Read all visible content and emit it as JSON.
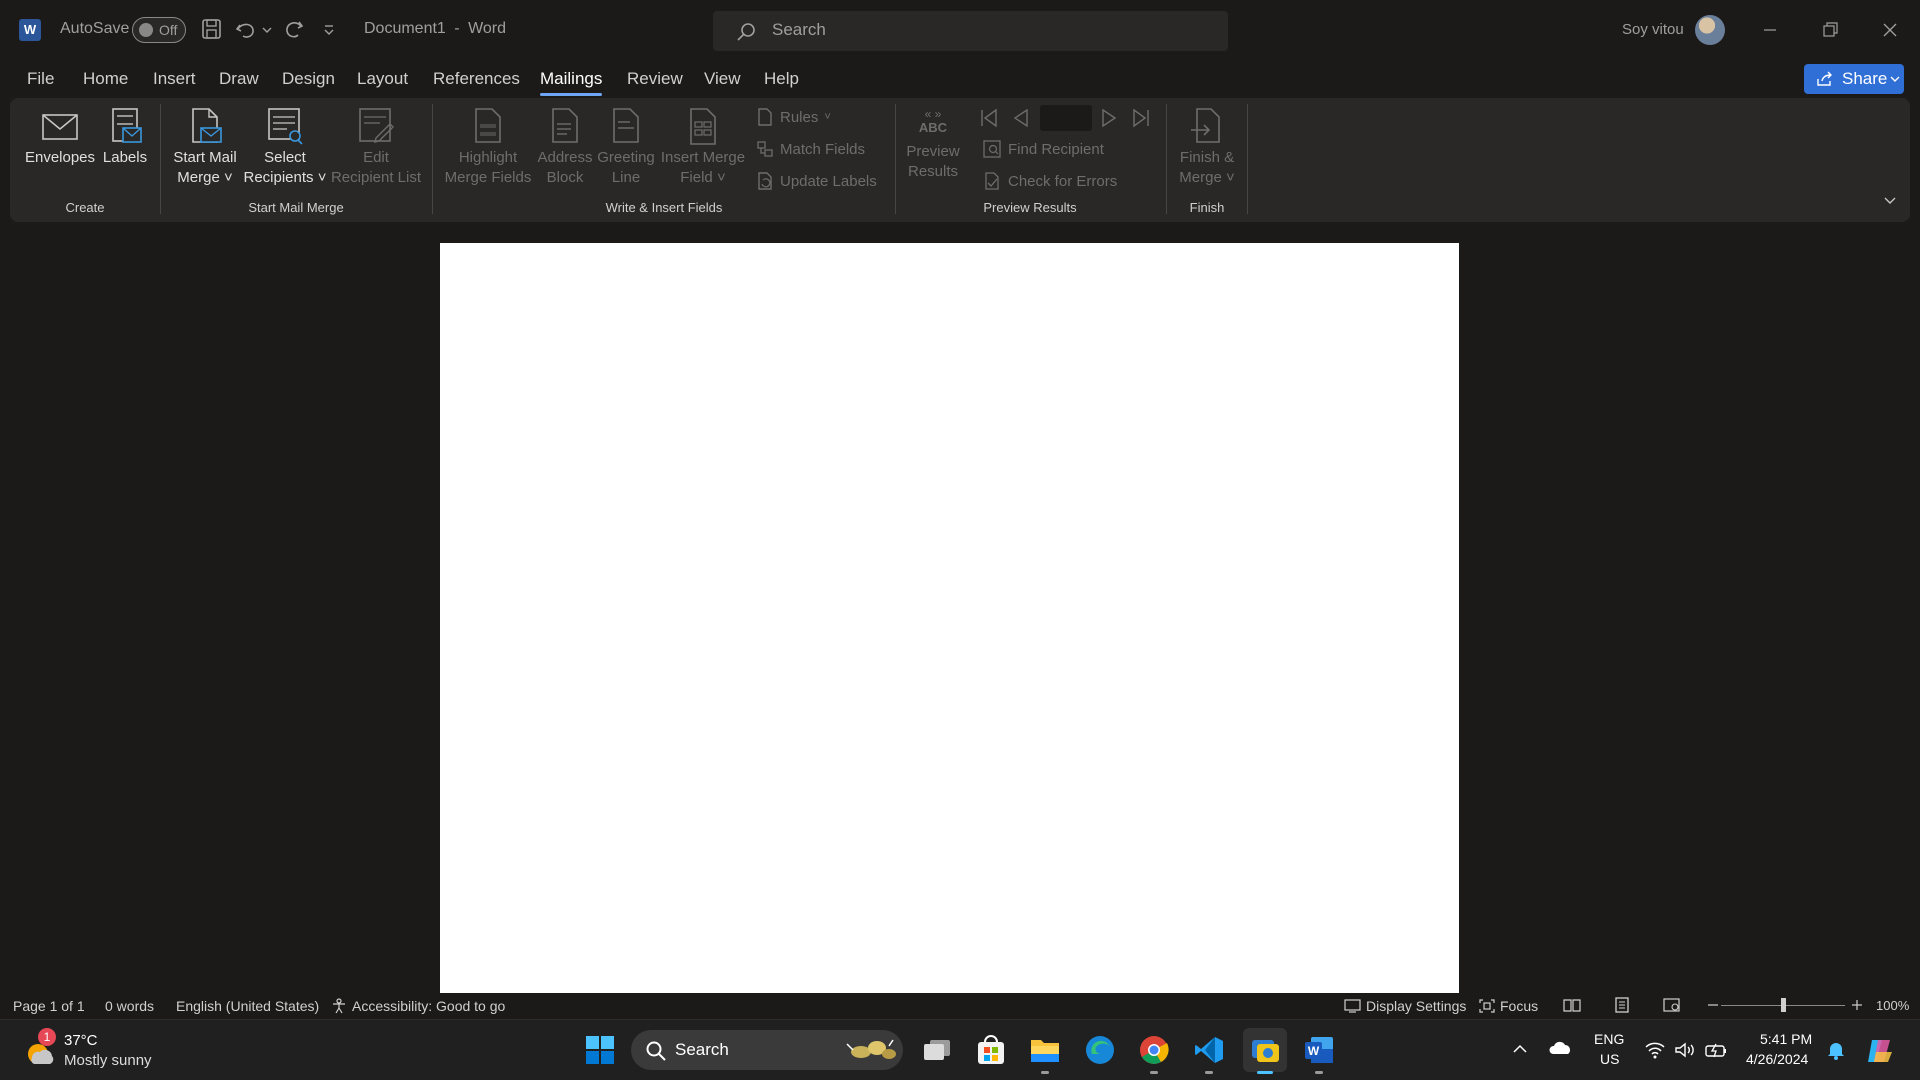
{
  "titlebar": {
    "autosave_label": "AutoSave",
    "autosave_state": "Off",
    "document_title": "Document1",
    "separator": "-",
    "app_name": "Word",
    "search_placeholder": "Search",
    "user_name": "Soy vitou"
  },
  "tabs": [
    "File",
    "Home",
    "Insert",
    "Draw",
    "Design",
    "Layout",
    "References",
    "Mailings",
    "Review",
    "View",
    "Help"
  ],
  "active_tab": "Mailings",
  "share_label": "Share",
  "ribbon": {
    "create": {
      "group": "Create",
      "envelopes": "Envelopes",
      "labels": "Labels"
    },
    "start_mail_merge": {
      "group": "Start Mail Merge",
      "start_l1": "Start Mail",
      "start_l2": "Merge",
      "select_l1": "Select",
      "select_l2": "Recipients",
      "edit_l1": "Edit",
      "edit_l2": "Recipient List"
    },
    "write_insert": {
      "group": "Write & Insert Fields",
      "highlight_l1": "Highlight",
      "highlight_l2": "Merge Fields",
      "address_l1": "Address",
      "address_l2": "Block",
      "greeting_l1": "Greeting",
      "greeting_l2": "Line",
      "insert_l1": "Insert Merge",
      "insert_l2": "Field",
      "rules": "Rules",
      "match_fields": "Match Fields",
      "update_labels": "Update Labels"
    },
    "preview": {
      "group": "Preview Results",
      "abc": "ABC",
      "preview_l1": "Preview",
      "preview_l2": "Results",
      "find_recipient": "Find Recipient",
      "check_errors": "Check for Errors"
    },
    "finish": {
      "group": "Finish",
      "finish_l1": "Finish &",
      "finish_l2": "Merge"
    }
  },
  "status": {
    "page": "Page 1 of 1",
    "words": "0 words",
    "language": "English (United States)",
    "accessibility": "Accessibility: Good to go",
    "display_settings": "Display Settings",
    "focus": "Focus",
    "zoom": "100%"
  },
  "taskbar": {
    "weather_badge": "1",
    "temperature": "37°C",
    "condition": "Mostly sunny",
    "search_label": "Search",
    "lang_l1": "ENG",
    "lang_l2": "US",
    "time": "5:41 PM",
    "date": "4/26/2024"
  },
  "colors": {
    "accent": "#2f6fd6",
    "active_tab_underline": "#6ea5f5",
    "word_blue": "#2b579a"
  }
}
